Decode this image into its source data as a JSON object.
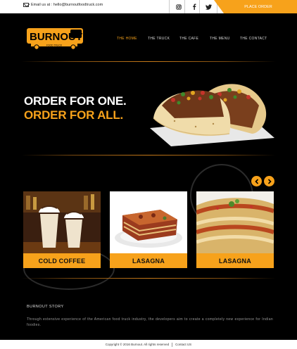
{
  "topbar": {
    "email_label": "Email us at : hello@burnoutfoodtruck.com",
    "social": [
      "instagram-icon",
      "facebook-icon",
      "twitter-icon"
    ],
    "place_order": "PLACE ORDER"
  },
  "logo": {
    "text": "BURNOUT",
    "tagline": "FOOD TRUCK"
  },
  "nav": [
    "THE HOME",
    "THE TRUCK",
    "THE CAFE",
    "THE MENU",
    "THE CONTACT"
  ],
  "hero": {
    "line1": "ORDER FOR ONE.",
    "line2": "ORDER FOR ALL."
  },
  "cards": [
    {
      "label": "COLD COFFEE"
    },
    {
      "label": "LASAGNA"
    },
    {
      "label": "LASAGNA"
    }
  ],
  "story": {
    "title": "BURNOUT STORY",
    "text": "Through extensive experience of the American food truck industry, the developers aim to create a completely new experience for Indian foodies."
  },
  "footer": {
    "copyright": "Copyright © 2016 Burnout. All rights reserved",
    "contact": "Contact US"
  },
  "colors": {
    "accent": "#f7a21b",
    "background": "#000000"
  }
}
